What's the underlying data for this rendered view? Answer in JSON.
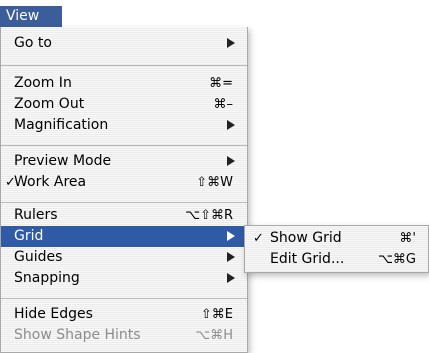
{
  "menu_title": "View",
  "main_menu": {
    "goto": {
      "label": "Go to"
    },
    "zoom_in": {
      "label": "Zoom In",
      "shortcut": "⌘="
    },
    "zoom_out": {
      "label": "Zoom Out",
      "shortcut": "⌘–"
    },
    "magnification": {
      "label": "Magnification"
    },
    "preview_mode": {
      "label": "Preview Mode"
    },
    "work_area": {
      "label": "Work Area",
      "shortcut": "⇧⌘W",
      "check": "✓"
    },
    "rulers": {
      "label": "Rulers",
      "shortcut": "⌥⇧⌘R"
    },
    "grid": {
      "label": "Grid"
    },
    "guides": {
      "label": "Guides"
    },
    "snapping": {
      "label": "Snapping"
    },
    "hide_edges": {
      "label": "Hide Edges",
      "shortcut": "⇧⌘E"
    },
    "show_shape_hints": {
      "label": "Show Shape Hints",
      "shortcut": "⌥⌘H"
    }
  },
  "grid_submenu": {
    "show_grid": {
      "label": "Show Grid",
      "shortcut": "⌘'",
      "check": "✓"
    },
    "edit_grid": {
      "label": "Edit Grid...",
      "shortcut": "⌥⌘G"
    }
  },
  "colors": {
    "highlight": "#2f5aa6",
    "menu_title_bg": "#3b5d99",
    "disabled_text": "#8c8c8c"
  }
}
